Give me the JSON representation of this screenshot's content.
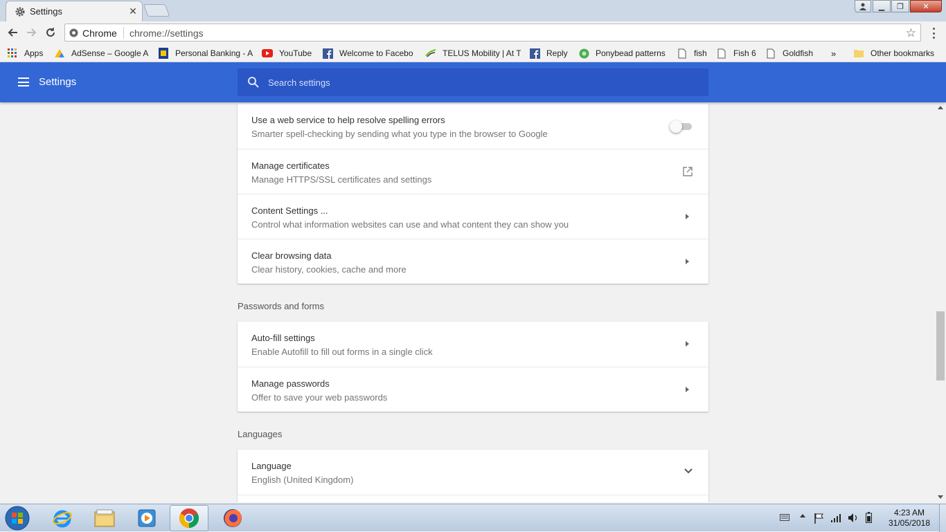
{
  "browser": {
    "tab_title": "Settings",
    "address_scheme": "Chrome",
    "address_url": "chrome://settings"
  },
  "bookmarks": [
    {
      "label": "Apps",
      "icon": "apps-grid-icon"
    },
    {
      "label": "AdSense – Google A",
      "icon": "adsense-icon"
    },
    {
      "label": "Personal Banking - A",
      "icon": "bank-icon"
    },
    {
      "label": "YouTube",
      "icon": "youtube-icon"
    },
    {
      "label": "Welcome to Facebo",
      "icon": "facebook-icon"
    },
    {
      "label": "TELUS Mobility | At T",
      "icon": "telus-icon"
    },
    {
      "label": "Reply",
      "icon": "facebook-icon"
    },
    {
      "label": "Ponybead patterns",
      "icon": "ponybead-icon"
    },
    {
      "label": "fish",
      "icon": "page-icon"
    },
    {
      "label": "Fish 6",
      "icon": "page-icon"
    },
    {
      "label": "Goldfish",
      "icon": "page-icon"
    },
    {
      "label": "»",
      "icon": ""
    },
    {
      "label": "Other bookmarks",
      "icon": "folder-icon"
    }
  ],
  "header": {
    "title": "Settings",
    "search_placeholder": "Search settings"
  },
  "sections": {
    "advanced_rows": [
      {
        "primary": "Use a web service to help resolve spelling errors",
        "secondary": "Smarter spell-checking by sending what you type in the browser to Google",
        "control": "toggle",
        "toggle_on": false
      },
      {
        "primary": "Manage certificates",
        "secondary": "Manage HTTPS/SSL certificates and settings",
        "control": "external"
      },
      {
        "primary": "Content Settings ...",
        "secondary": "Control what information websites can use and what content they can show you",
        "control": "arrow"
      },
      {
        "primary": "Clear browsing data",
        "secondary": "Clear history, cookies, cache and more",
        "control": "arrow"
      }
    ],
    "passwords_title": "Passwords and forms",
    "passwords_rows": [
      {
        "primary": "Auto-fill settings",
        "secondary": "Enable Autofill to fill out forms in a single click",
        "control": "arrow"
      },
      {
        "primary": "Manage passwords",
        "secondary": "Offer to save your web passwords",
        "control": "arrow"
      }
    ],
    "languages_title": "Languages",
    "languages_rows": [
      {
        "primary": "Language",
        "secondary": "English (United Kingdom)",
        "control": "expand"
      }
    ]
  },
  "taskbar": {
    "time": "4:23 AM",
    "date": "31/05/2018"
  },
  "colors": {
    "header_blue": "#3367d6",
    "search_blue": "#2a56c6"
  }
}
